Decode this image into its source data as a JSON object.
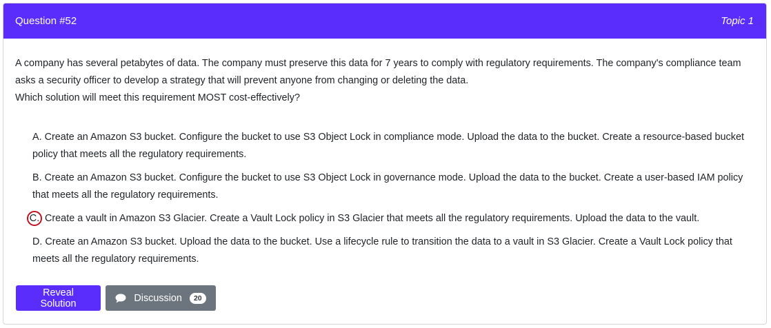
{
  "header": {
    "question_number": "Question #52",
    "topic": "Topic 1"
  },
  "question": {
    "paragraph_1": "A company has several petabytes of data. The company must preserve this data for 7 years to comply with regulatory requirements. The company's compliance team asks a security officer to develop a strategy that will prevent anyone from changing or deleting the data.",
    "paragraph_2": "Which solution will meet this requirement MOST cost-effectively?"
  },
  "choices": [
    {
      "letter": "A.",
      "text": " Create an Amazon S3 bucket. Configure the bucket to use S3 Object Lock in compliance mode. Upload the data to the bucket. Create a resource-based bucket policy that meets all the regulatory requirements.",
      "selected": false
    },
    {
      "letter": "B.",
      "text": " Create an Amazon S3 bucket. Configure the bucket to use S3 Object Lock in governance mode. Upload the data to the bucket. Create a user-based IAM policy that meets all the regulatory requirements.",
      "selected": false
    },
    {
      "letter": "C.",
      "text": " Create a vault in Amazon S3 Glacier. Create a Vault Lock policy in S3 Glacier that meets all the regulatory requirements. Upload the data to the vault.",
      "selected": true
    },
    {
      "letter": "D.",
      "text": " Create an Amazon S3 bucket. Upload the data to the bucket. Use a lifecycle rule to transition the data to a vault in S3 Glacier. Create a Vault Lock policy that meets all the regulatory requirements.",
      "selected": false
    }
  ],
  "actions": {
    "reveal_label": "Reveal Solution",
    "discussion_label": "Discussion",
    "discussion_count": "20",
    "discussion_icon": "comment-icon"
  },
  "colors": {
    "header_bg": "#5a2dfc",
    "secondary_btn": "#6c757d",
    "selected_circle": "#c0131f"
  }
}
